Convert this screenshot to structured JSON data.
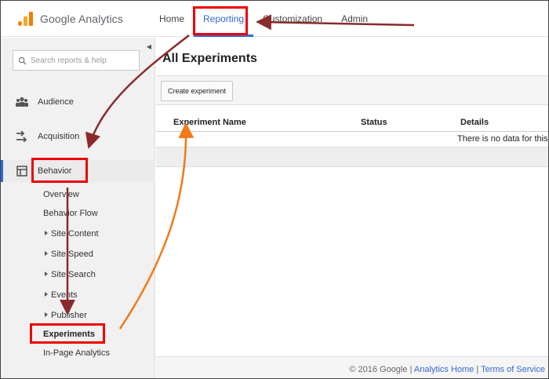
{
  "app": {
    "logo_text": "Google Analytics"
  },
  "nav": {
    "items": [
      {
        "label": "Home",
        "active": false
      },
      {
        "label": "Reporting",
        "active": true
      },
      {
        "label": "Customization",
        "active": false
      },
      {
        "label": "Admin",
        "active": false
      }
    ]
  },
  "sidebar": {
    "search_placeholder": "Search reports & help",
    "sections": [
      {
        "label": "Audience",
        "icon": "people-icon"
      },
      {
        "label": "Acquisition",
        "icon": "acquisition-arrows-icon"
      },
      {
        "label": "Behavior",
        "icon": "behavior-layout-icon",
        "active": true
      }
    ],
    "behavior_items": [
      {
        "label": "Overview"
      },
      {
        "label": "Behavior Flow"
      },
      {
        "label": "Site Content",
        "expandable": true
      },
      {
        "label": "Site Speed",
        "expandable": true
      },
      {
        "label": "Site Search",
        "expandable": true
      },
      {
        "label": "Events",
        "expandable": true
      },
      {
        "label": "Publisher",
        "expandable": true
      },
      {
        "label": "Experiments",
        "selected": true
      },
      {
        "label": "In-Page Analytics"
      }
    ]
  },
  "main": {
    "title": "All Experiments",
    "create_button": "Create experiment",
    "columns": [
      "Experiment Name",
      "Status",
      "Details"
    ],
    "empty_text": "There is no data for this"
  },
  "footer": {
    "copyright": "© 2016 Google",
    "separator": "|",
    "links": [
      "Analytics Home",
      "Terms of Service"
    ]
  },
  "annotation_colors": {
    "highlight": "#e00000",
    "arrow_dark": "#8b2a2a",
    "arrow_orange": "#f07a1a"
  }
}
